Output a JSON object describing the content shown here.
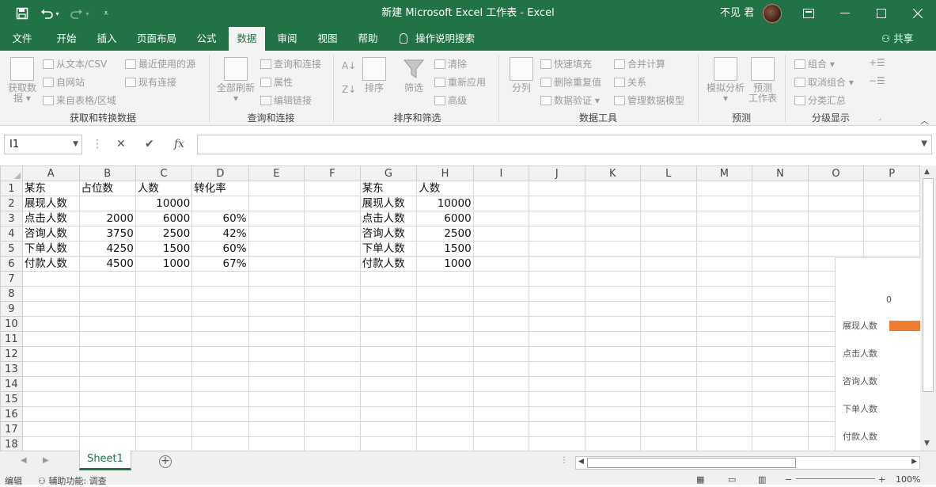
{
  "titlebar": {
    "title": "新建 Microsoft Excel 工作表  -  Excel",
    "user": "不见 君",
    "save_icon": "save-icon",
    "undo_icon": "undo-icon",
    "redo_icon": "redo-icon"
  },
  "ribbon_tabs": [
    {
      "label": "文件"
    },
    {
      "label": "开始"
    },
    {
      "label": "插入"
    },
    {
      "label": "页面布局"
    },
    {
      "label": "公式"
    },
    {
      "label": "数据"
    },
    {
      "label": "审阅"
    },
    {
      "label": "视图"
    },
    {
      "label": "帮助"
    }
  ],
  "active_tab": "数据",
  "tell_me": "操作说明搜索",
  "share": "共享",
  "ribbon": {
    "get_data": "获取数",
    "get_data_2": "据",
    "from_text_csv": "从文本/CSV",
    "from_web": "自网站",
    "from_table": "来自表格/区域",
    "recent_sources": "最近使用的源",
    "existing_connections": "现有连接",
    "group_get_transform": "获取和转换数据",
    "refresh_all": "全部刷新",
    "queries_connections": "查询和连接",
    "properties": "属性",
    "edit_links": "编辑链接",
    "group_queries": "查询和连接",
    "sort": "排序",
    "filter": "筛选",
    "clear": "清除",
    "reapply": "重新应用",
    "advanced": "高级",
    "group_sort_filter": "排序和筛选",
    "text_to_columns": "分列",
    "flash_fill": "快速填充",
    "remove_duplicates": "删除重复值",
    "data_validation": "数据验证",
    "consolidate": "合并计算",
    "relationships": "关系",
    "manage_data_model": "管理数据模型",
    "group_data_tools": "数据工具",
    "what_if": "模拟分析",
    "forecast_sheet": "预测",
    "forecast_sheet_2": "工作表",
    "group_forecast": "预测",
    "group": "组合",
    "ungroup": "取消组合",
    "subtotal": "分类汇总",
    "group_outline": "分级显示"
  },
  "formula_bar": {
    "name_box": "I1",
    "formula": "",
    "fx": "fx"
  },
  "columns": [
    "A",
    "B",
    "C",
    "D",
    "E",
    "F",
    "G",
    "H",
    "I",
    "J",
    "K",
    "L",
    "M",
    "N",
    "O",
    "P"
  ],
  "rows": [
    [
      "某东",
      "占位数",
      "人数",
      "转化率",
      "",
      "",
      "某东",
      "人数",
      "",
      "",
      "",
      "",
      "",
      "",
      "",
      ""
    ],
    [
      "展现人数",
      "",
      "10000",
      "",
      "",
      "",
      "展现人数",
      "10000",
      "",
      "",
      "",
      "",
      "",
      "",
      "",
      ""
    ],
    [
      "点击人数",
      "2000",
      "6000",
      "60%",
      "",
      "",
      "点击人数",
      "6000",
      "",
      "",
      "",
      "",
      "",
      "",
      "",
      ""
    ],
    [
      "咨询人数",
      "3750",
      "2500",
      "42%",
      "",
      "",
      "咨询人数",
      "2500",
      "",
      "",
      "",
      "",
      "",
      "",
      "",
      ""
    ],
    [
      "下单人数",
      "4250",
      "1500",
      "60%",
      "",
      "",
      "下单人数",
      "1500",
      "",
      "",
      "",
      "",
      "",
      "",
      "",
      ""
    ],
    [
      "付款人数",
      "4500",
      "1000",
      "67%",
      "",
      "",
      "付款人数",
      "1000",
      "",
      "",
      "",
      "",
      "",
      "",
      "",
      ""
    ],
    [
      "",
      "",
      "",
      "",
      "",
      "",
      "",
      "",
      "",
      "",
      "",
      "",
      "",
      "",
      "",
      ""
    ],
    [
      "",
      "",
      "",
      "",
      "",
      "",
      "",
      "",
      "",
      "",
      "",
      "",
      "",
      "",
      "",
      ""
    ],
    [
      "",
      "",
      "",
      "",
      "",
      "",
      "",
      "",
      "",
      "",
      "",
      "",
      "",
      "",
      "",
      ""
    ],
    [
      "",
      "",
      "",
      "",
      "",
      "",
      "",
      "",
      "",
      "",
      "",
      "",
      "",
      "",
      "",
      ""
    ],
    [
      "",
      "",
      "",
      "",
      "",
      "",
      "",
      "",
      "",
      "",
      "",
      "",
      "",
      "",
      "",
      ""
    ],
    [
      "",
      "",
      "",
      "",
      "",
      "",
      "",
      "",
      "",
      "",
      "",
      "",
      "",
      "",
      "",
      ""
    ],
    [
      "",
      "",
      "",
      "",
      "",
      "",
      "",
      "",
      "",
      "",
      "",
      "",
      "",
      "",
      "",
      ""
    ],
    [
      "",
      "",
      "",
      "",
      "",
      "",
      "",
      "",
      "",
      "",
      "",
      "",
      "",
      "",
      "",
      ""
    ],
    [
      "",
      "",
      "",
      "",
      "",
      "",
      "",
      "",
      "",
      "",
      "",
      "",
      "",
      "",
      "",
      ""
    ],
    [
      "",
      "",
      "",
      "",
      "",
      "",
      "",
      "",
      "",
      "",
      "",
      "",
      "",
      "",
      "",
      ""
    ],
    [
      "",
      "",
      "",
      "",
      "",
      "",
      "",
      "",
      "",
      "",
      "",
      "",
      "",
      "",
      "",
      ""
    ],
    [
      "",
      "",
      "",
      "",
      "",
      "",
      "",
      "",
      "",
      "",
      "",
      "",
      "",
      "",
      "",
      ""
    ]
  ],
  "numeric_columns": [
    1,
    2,
    3,
    7
  ],
  "chart": {
    "axis_label": "0",
    "categories": [
      "展现人数",
      "点击人数",
      "咨询人数",
      "下单人数",
      "付款人数"
    ],
    "bar_color": "#ed7d31"
  },
  "sheet_tab": "Sheet1",
  "status": {
    "mode": "编辑",
    "accessibility": "辅助功能: 调查",
    "zoom": "100%"
  },
  "colors": {
    "brand": "#217346",
    "accent_bar": "#ed7d31"
  }
}
